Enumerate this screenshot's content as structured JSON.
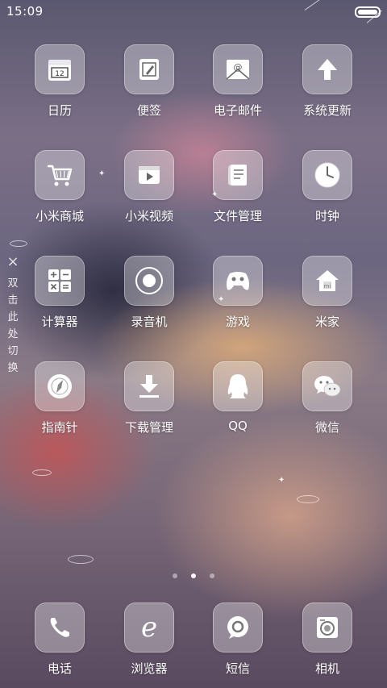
{
  "status": {
    "time": "15:09"
  },
  "side_hint": {
    "close_glyph": "×",
    "text": [
      "双",
      "击",
      "此",
      "处",
      "切",
      "换"
    ]
  },
  "apps": [
    {
      "label": "日历",
      "icon": "calendar-icon",
      "glyph": "12"
    },
    {
      "label": "便签",
      "icon": "notes-icon"
    },
    {
      "label": "电子邮件",
      "icon": "email-icon",
      "glyph": "@"
    },
    {
      "label": "系统更新",
      "icon": "update-icon",
      "glyph": "⬆"
    },
    {
      "label": "小米商城",
      "icon": "shopping-cart-icon",
      "glyph": "🛒"
    },
    {
      "label": "小米视频",
      "icon": "video-icon",
      "glyph": "▶"
    },
    {
      "label": "文件管理",
      "icon": "file-manager-icon"
    },
    {
      "label": "时钟",
      "icon": "clock-icon"
    },
    {
      "label": "计算器",
      "icon": "calculator-icon"
    },
    {
      "label": "录音机",
      "icon": "recorder-icon"
    },
    {
      "label": "游戏",
      "icon": "gamepad-icon"
    },
    {
      "label": "米家",
      "icon": "smart-home-icon",
      "glyph": "mi"
    },
    {
      "label": "指南针",
      "icon": "compass-icon"
    },
    {
      "label": "下载管理",
      "icon": "download-icon"
    },
    {
      "label": "QQ",
      "icon": "qq-icon"
    },
    {
      "label": "微信",
      "icon": "wechat-icon"
    }
  ],
  "dock": [
    {
      "label": "电话",
      "icon": "phone-icon",
      "glyph": "✆"
    },
    {
      "label": "浏览器",
      "icon": "browser-icon",
      "glyph": "e"
    },
    {
      "label": "短信",
      "icon": "messages-icon"
    },
    {
      "label": "相机",
      "icon": "camera-icon"
    }
  ],
  "pages": {
    "count": 3,
    "active": 2
  }
}
